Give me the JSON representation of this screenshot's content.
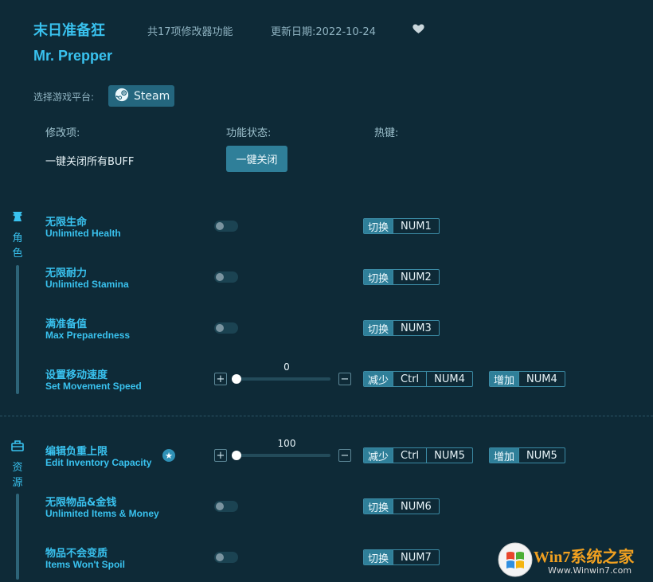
{
  "header": {
    "title_cn": "末日准备狂",
    "title_en": "Mr. Prepper",
    "feature_count": "共17项修改器功能",
    "update_date": "更新日期:2022-10-24",
    "favorite_icon": "heart-icon"
  },
  "platform": {
    "label": "选择游戏平台:",
    "button": "Steam",
    "icon": "steam-icon"
  },
  "columns": {
    "mod": "修改项:",
    "status": "功能状态:",
    "hotkey": "热键:"
  },
  "global": {
    "label": "一键关闭所有BUFF",
    "button": "一键关闭"
  },
  "sections": [
    {
      "label": "角色",
      "icon": "character-icon",
      "items": [
        {
          "cn": "无限生命",
          "en": "Unlimited Health",
          "control": "toggle",
          "on": false,
          "keys": [
            {
              "tag": "切换",
              "keys": [
                "NUM1"
              ]
            }
          ]
        },
        {
          "cn": "无限耐力",
          "en": "Unlimited Stamina",
          "control": "toggle",
          "on": false,
          "keys": [
            {
              "tag": "切换",
              "keys": [
                "NUM2"
              ]
            }
          ]
        },
        {
          "cn": "满准备值",
          "en": "Max Preparedness",
          "control": "toggle",
          "on": false,
          "keys": [
            {
              "tag": "切换",
              "keys": [
                "NUM3"
              ]
            }
          ]
        },
        {
          "cn": "设置移动速度",
          "en": "Set Movement Speed",
          "control": "slider",
          "value": "0",
          "fraction": 0,
          "keys": [
            {
              "tag": "减少",
              "keys": [
                "Ctrl",
                "NUM4"
              ]
            },
            {
              "tag": "增加",
              "keys": [
                "NUM4"
              ]
            }
          ]
        }
      ]
    },
    {
      "label": "资源",
      "icon": "resources-icon",
      "items": [
        {
          "cn": "编辑负重上限",
          "en": "Edit Inventory Capacity",
          "control": "slider",
          "value": "100",
          "fraction": 0,
          "featured": true,
          "keys": [
            {
              "tag": "减少",
              "keys": [
                "Ctrl",
                "NUM5"
              ]
            },
            {
              "tag": "增加",
              "keys": [
                "NUM5"
              ]
            }
          ]
        },
        {
          "cn": "无限物品&金钱",
          "en": "Unlimited Items & Money",
          "control": "toggle",
          "on": false,
          "keys": [
            {
              "tag": "切换",
              "keys": [
                "NUM6"
              ]
            }
          ]
        },
        {
          "cn": "物品不会变质",
          "en": "Items Won't Spoil",
          "control": "toggle",
          "on": false,
          "keys": [
            {
              "tag": "切换",
              "keys": [
                "NUM7"
              ]
            }
          ]
        }
      ]
    }
  ],
  "slider_buttons": {
    "plus": "+",
    "minus": "−"
  },
  "watermark": {
    "brand": "Win7系统之家",
    "url": "Www.Winwin7.com"
  },
  "colors": {
    "background": "#0e2a37",
    "accent": "#39c2ef",
    "button": "#2f7f99",
    "watermark": "#f0a020"
  }
}
